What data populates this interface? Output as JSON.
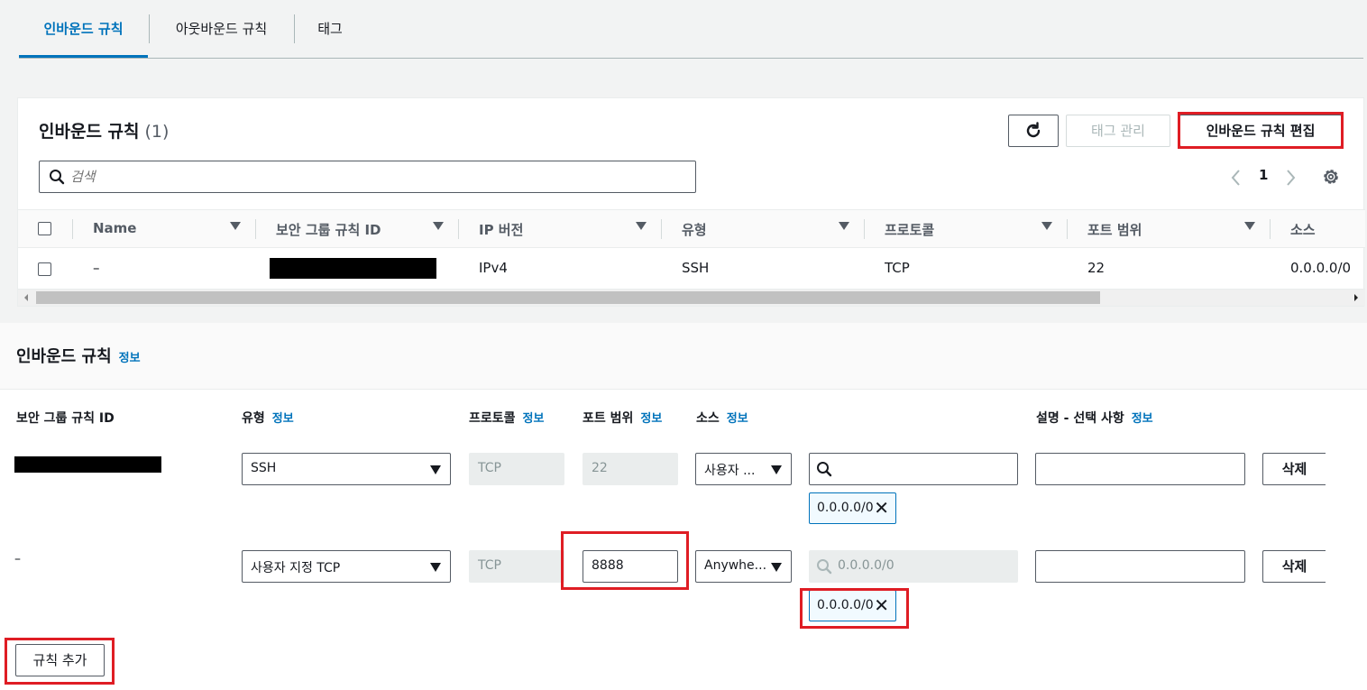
{
  "tabs": [
    {
      "label": "인바운드 규칙"
    },
    {
      "label": "아웃바운드 규칙"
    },
    {
      "label": "태그"
    }
  ],
  "panel": {
    "title": "인바운드 규칙",
    "count": "(1)",
    "refresh_icon": "refresh-icon",
    "manage_tags_label": "태그 관리",
    "edit_rules_label": "인바운드 규칙 편집",
    "search_placeholder": "검색",
    "page_number": "1",
    "columns": [
      "Name",
      "보안 그룹 규칙 ID",
      "IP 버전",
      "유형",
      "프로토콜",
      "포트 범위",
      "소스"
    ],
    "rows": [
      {
        "name": "–",
        "ip_version": "IPv4",
        "type": "SSH",
        "protocol": "TCP",
        "port_range": "22",
        "source": "0.0.0.0/0"
      }
    ]
  },
  "edit": {
    "title": "인바운드 규칙",
    "info_label": "정보",
    "labels": {
      "rule_id": "보안 그룹 규칙 ID",
      "type": "유형",
      "protocol": "프로토콜",
      "port_range": "포트 범위",
      "source": "소스",
      "description": "설명 - 선택 사항"
    },
    "rules": [
      {
        "rule_id": "",
        "type": "SSH",
        "protocol": "TCP",
        "port_range": "22",
        "source_type": "사용자 ...",
        "source_search": "",
        "source_token": "0.0.0.0/0",
        "description": "",
        "delete_label": "삭제"
      },
      {
        "rule_id": "–",
        "type": "사용자 지정 TCP",
        "protocol": "TCP",
        "port_range": "8888",
        "source_type": "Anywhe...",
        "source_search_placeholder": "0.0.0.0/0",
        "source_token": "0.0.0.0/0",
        "description": "",
        "delete_label": "삭제"
      }
    ],
    "add_rule_label": "규칙 추가"
  },
  "colors": {
    "accent": "#0073bb",
    "highlight": "#df1d24"
  }
}
